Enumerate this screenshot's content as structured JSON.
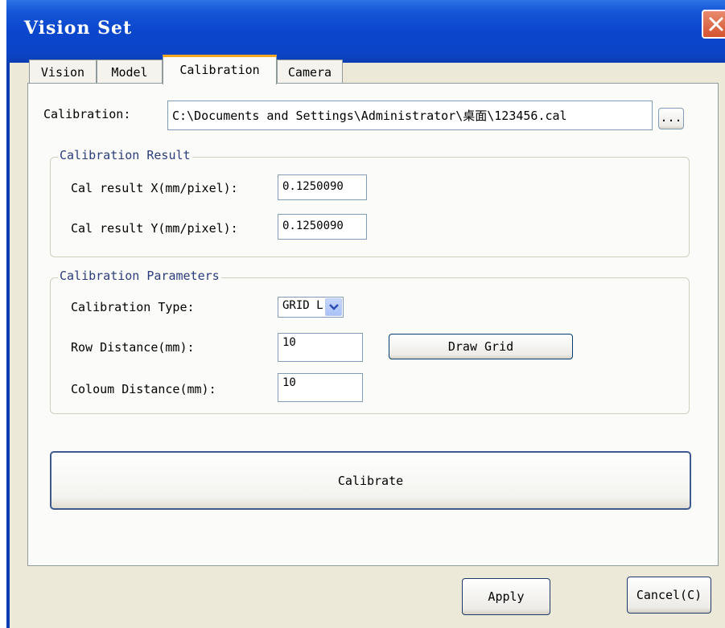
{
  "window": {
    "title": "Vision Set"
  },
  "tabs": [
    {
      "label": "Vision"
    },
    {
      "label": "Model"
    },
    {
      "label": "Calibration",
      "active": true
    },
    {
      "label": "Camera"
    }
  ],
  "calibration_file": {
    "label": "Calibration:",
    "value": "C:\\Documents and Settings\\Administrator\\桌面\\123456.cal",
    "browse_label": "..."
  },
  "result_group": {
    "title": "Calibration Result",
    "x_label": "Cal result X(mm/pixel):",
    "x_value": "0.1250090",
    "y_label": "Cal result Y(mm/pixel):",
    "y_value": "0.1250090"
  },
  "params_group": {
    "title": "Calibration Parameters",
    "type_label": "Calibration Type:",
    "type_value": "GRID L",
    "row_label": "Row Distance(mm):",
    "row_value": "10",
    "draw_grid_label": "Draw Grid",
    "col_label": "Coloum Distance(mm):",
    "col_value": "10"
  },
  "calibrate_label": "Calibrate",
  "footer": {
    "apply_label": "Apply",
    "cancel_label": "Cancel(C)"
  },
  "colors": {
    "titlebar": "#0a46cd",
    "dialog_bg": "#ece9d8",
    "close_button": "#d4532f",
    "tab_highlight": "#f5a623"
  },
  "icons": {
    "close": "close-x-icon",
    "dropdown": "chevron-down-icon"
  }
}
